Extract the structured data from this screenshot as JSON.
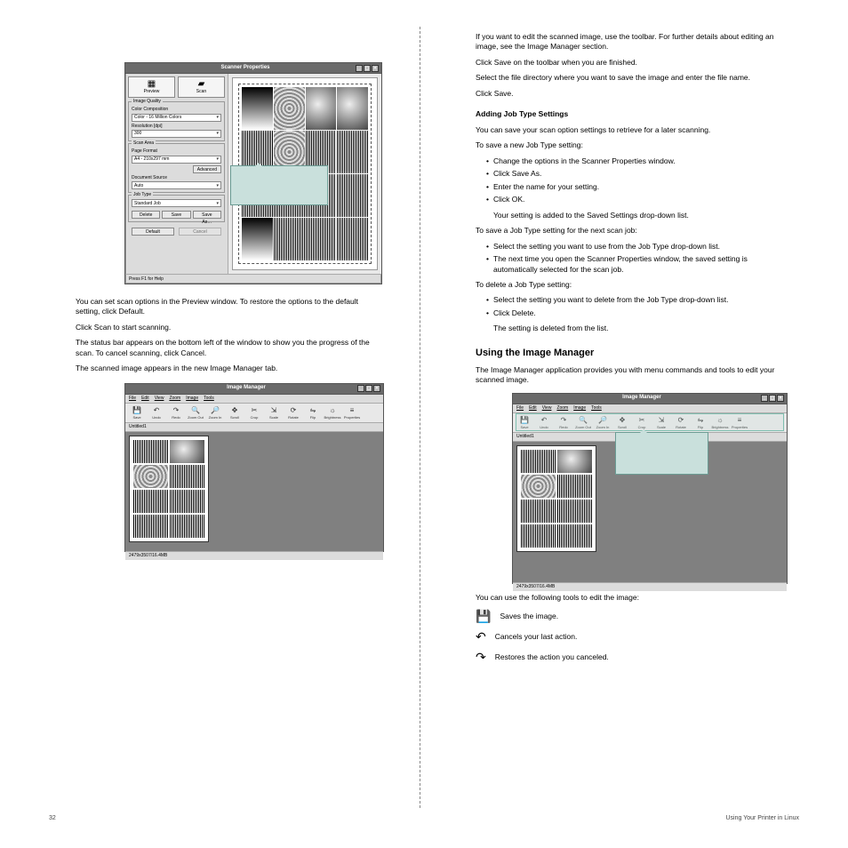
{
  "scanner": {
    "title": "Scanner Properties",
    "previewBtn": "Preview",
    "scanBtn": "Scan",
    "grp_image": "Image Quality",
    "lbl_colorComp": "Color Composition",
    "val_colorComp": "Color - 16 Million Colors",
    "lbl_res": "Resolution [dpi]",
    "val_res": "300",
    "grp_scanArea": "Scan Area",
    "lbl_pageFormat": "Page Format",
    "val_pageFormat": "A4 - 210x297 mm",
    "btn_advanced": "Advanced",
    "lbl_docSource": "Document Source",
    "val_docSource": "Auto",
    "grp_jobType": "Job Type",
    "val_jobType": "Standard Job",
    "btn_delete": "Delete",
    "btn_save": "Save",
    "btn_saveAs": "Save As…",
    "btn_default": "Default",
    "btn_cancel": "Cancel",
    "status": "Press F1 for Help"
  },
  "leftText": {
    "p1": "You can set scan options in the Preview window. To restore the options to the default setting, click Default.",
    "p2": "Click Scan to start scanning.",
    "p3": "The status bar appears on the bottom left of the window to show you the progress of the scan. To cancel scanning, click Cancel.",
    "p4": "The scanned image appears in the new Image Manager tab.",
    "h2": "Using the Image Manager",
    "p6": "The Image Manager application provides you with menu commands and tools to edit your scanned image."
  },
  "imgmgr": {
    "title": "Image Manager",
    "menu": [
      "File",
      "Edit",
      "View",
      "Zoom",
      "Image",
      "Tools"
    ],
    "tools": [
      {
        "label": "Save",
        "icon": "💾"
      },
      {
        "label": "Undo",
        "icon": "↶"
      },
      {
        "label": "Redo",
        "icon": "↷"
      },
      {
        "label": "Zoom Out",
        "icon": "🔍"
      },
      {
        "label": "Zoom In",
        "icon": "🔎"
      },
      {
        "label": "Scroll",
        "icon": "✥"
      },
      {
        "label": "Crop",
        "icon": "✂"
      },
      {
        "label": "Scale",
        "icon": "⇲"
      },
      {
        "label": "Rotate",
        "icon": "⟳"
      },
      {
        "label": "Flip",
        "icon": "⇋"
      },
      {
        "label": "Brightness",
        "icon": "☼"
      },
      {
        "label": "Properties",
        "icon": "≡"
      }
    ],
    "tab": "Untitled1",
    "status": "2479x3507/16.4MB"
  },
  "rightText": {
    "p1": "If you want to edit the scanned image, use the toolbar. For further details about editing an image, see the Image Manager section.",
    "p2": "Click Save on the toolbar when you are finished.",
    "p3": "Select the file directory where you want to save the image and enter the file name.",
    "p4": "Click Save.",
    "h_jobtype": "Adding Job Type Settings",
    "jt_intro": "You can save your scan option settings to retrieve for a later scanning.",
    "jt_new": "To save a new Job Type setting:",
    "jt_new1": "Change the options in the Scanner Properties window.",
    "jt_new2": "Click Save As.",
    "jt_new3": "Enter the name for your setting.",
    "jt_new4": "Click OK.",
    "jt_new5": "Your setting is added to the Saved Settings drop-down list.",
    "jt_next": "To save a Job Type setting for the next scan job:",
    "jt_next1": "Select the setting you want to use from the Job Type drop-down list.",
    "jt_next2": "The next time you open the Scanner Properties window, the saved setting is automatically selected for the scan job.",
    "jt_del": "To delete a Job Type setting:",
    "jt_del1": "Select the setting you want to delete from the Job Type drop-down list.",
    "jt_del2": "Click Delete.",
    "jt_del3": "The setting is deleted from the list.",
    "h_using": "Using the Image Manager",
    "using_intro": "The Image Manager application provides you with menu commands and tools to edit your scanned image.",
    "tools_intro": "You can use the following tools to edit the image:",
    "tool_save": "Saves the image.",
    "tool_undo": "Cancels your last action.",
    "tool_redo": "Restores the action you canceled."
  },
  "footer": {
    "page": "32",
    "label_left": "Using Your Printer in Linux"
  }
}
